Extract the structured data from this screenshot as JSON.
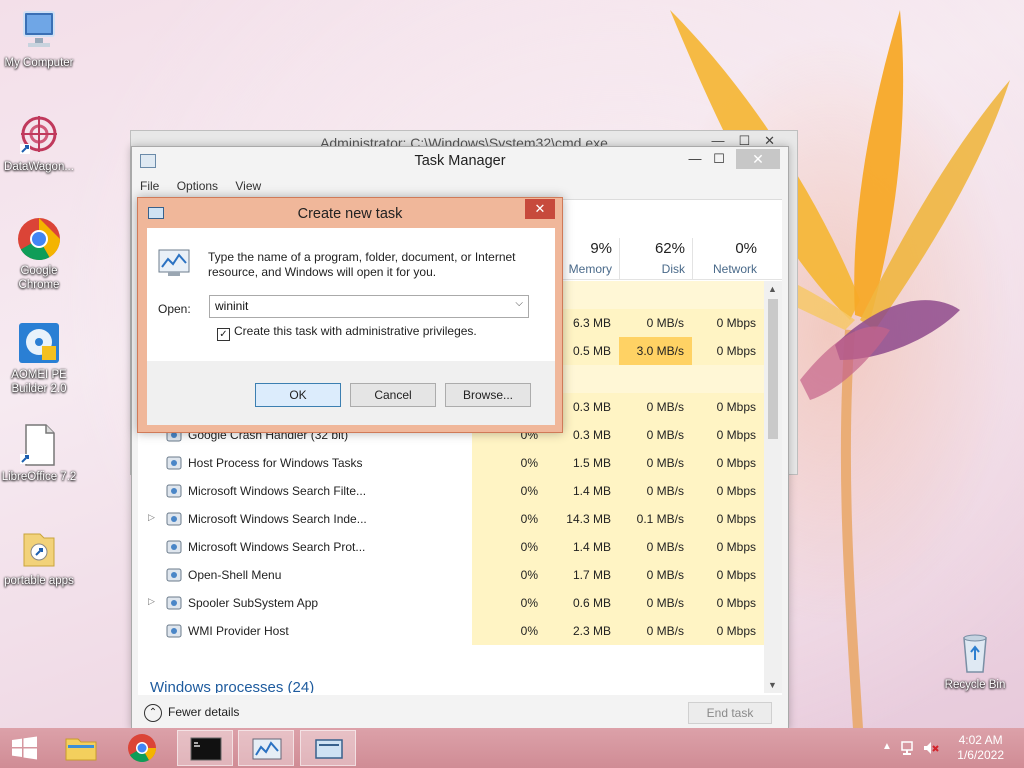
{
  "desktop": {
    "icons": [
      {
        "label": "My Computer",
        "icon": "computer-icon"
      },
      {
        "label": "DataWagon...",
        "icon": "datawagon-icon"
      },
      {
        "label": "Google Chrome",
        "icon": "chrome-icon"
      },
      {
        "label": "AOMEI PE Builder 2.0",
        "icon": "aomei-icon"
      },
      {
        "label": "LibreOffice 7.2",
        "icon": "libreoffice-icon"
      },
      {
        "label": "portable apps",
        "icon": "folder-icon"
      },
      {
        "label": "Recycle Bin",
        "icon": "recycle-bin-icon"
      }
    ]
  },
  "cmd_window": {
    "title": "Administrator: C:\\Windows\\System32\\cmd.exe"
  },
  "task_manager": {
    "title": "Task Manager",
    "menu": [
      "File",
      "Options",
      "View"
    ],
    "columns": [
      {
        "pct": "9%",
        "name": "Memory"
      },
      {
        "pct": "62%",
        "name": "Disk"
      },
      {
        "pct": "0%",
        "name": "Network"
      }
    ],
    "rows": [
      {
        "name": "",
        "cpu": "",
        "mem": "",
        "disk": "",
        "net": "",
        "blank": true
      },
      {
        "name": "",
        "cpu": "",
        "mem": "6.3 MB",
        "disk": "0 MB/s",
        "net": "0 Mbps"
      },
      {
        "name": "",
        "cpu": "",
        "mem": "0.5 MB",
        "disk": "3.0 MB/s",
        "net": "0 Mbps",
        "hot": true
      },
      {
        "name": "",
        "cpu": "",
        "mem": "",
        "disk": "",
        "net": "",
        "blank": true
      },
      {
        "name": "",
        "cpu": "",
        "mem": "0.3 MB",
        "disk": "0 MB/s",
        "net": "0 Mbps"
      },
      {
        "name": "Google Crash Handler (32 bit)",
        "cpu": "0%",
        "mem": "0.3 MB",
        "disk": "0 MB/s",
        "net": "0 Mbps",
        "icon": "crash-handler-icon"
      },
      {
        "name": "Host Process for Windows Tasks",
        "cpu": "0%",
        "mem": "1.5 MB",
        "disk": "0 MB/s",
        "net": "0 Mbps",
        "icon": "window-process-icon"
      },
      {
        "name": "Microsoft Windows Search Filte...",
        "cpu": "0%",
        "mem": "1.4 MB",
        "disk": "0 MB/s",
        "net": "0 Mbps",
        "icon": "search-service-icon"
      },
      {
        "name": "Microsoft Windows Search Inde...",
        "cpu": "0%",
        "mem": "14.3 MB",
        "disk": "0.1 MB/s",
        "net": "0 Mbps",
        "icon": "search-service-icon",
        "expand": true
      },
      {
        "name": "Microsoft Windows Search Prot...",
        "cpu": "0%",
        "mem": "1.4 MB",
        "disk": "0 MB/s",
        "net": "0 Mbps",
        "icon": "search-service-icon"
      },
      {
        "name": "Open-Shell Menu",
        "cpu": "0%",
        "mem": "1.7 MB",
        "disk": "0 MB/s",
        "net": "0 Mbps",
        "icon": "shell-icon"
      },
      {
        "name": "Spooler SubSystem App",
        "cpu": "0%",
        "mem": "0.6 MB",
        "disk": "0 MB/s",
        "net": "0 Mbps",
        "icon": "printer-icon",
        "expand": true
      },
      {
        "name": "WMI Provider Host",
        "cpu": "0%",
        "mem": "2.3 MB",
        "disk": "0 MB/s",
        "net": "0 Mbps",
        "icon": "wmi-icon"
      }
    ],
    "section_title": "Windows processes (24)",
    "fewer_details": "Fewer details",
    "end_task": "End task"
  },
  "dialog": {
    "title": "Create new task",
    "description": "Type the name of a program, folder, document, or Internet resource, and Windows will open it for you.",
    "open_label": "Open:",
    "open_value": "wininit",
    "admin_label": "Create this task with administrative privileges.",
    "admin_checked": true,
    "ok": "OK",
    "cancel": "Cancel",
    "browse": "Browse..."
  },
  "taskbar": {
    "items": [
      "start-button",
      "file-explorer",
      "chrome",
      "cmd",
      "task-manager",
      "run-dialog"
    ],
    "active_items": [
      "cmd",
      "task-manager",
      "run-dialog"
    ],
    "time": "4:02 AM",
    "date": "1/6/2022"
  }
}
